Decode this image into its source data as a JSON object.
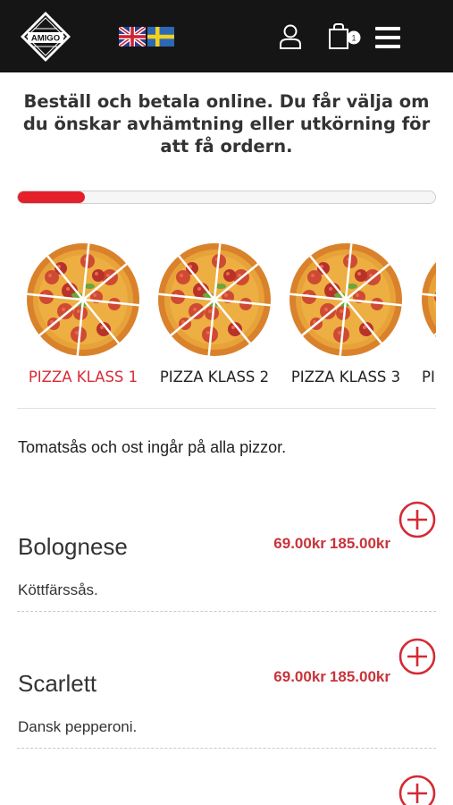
{
  "header": {
    "logo_text": "AMIGO",
    "languages": [
      "English",
      "Svenska"
    ],
    "cart_count": "1",
    "colors": {
      "bar": "#151515",
      "accent": "#e4202a"
    }
  },
  "intro": {
    "text": "Beställ och betala online. Du får välja om du önskar avhämtning eller utkörning för att få ordern."
  },
  "progress": {
    "value": 0.16
  },
  "categories": [
    {
      "label": "PIZZA KLASS 1",
      "active": true
    },
    {
      "label": "PIZZA KLASS 2",
      "active": false
    },
    {
      "label": "PIZZA KLASS 3",
      "active": false
    },
    {
      "label": "PI",
      "active": false
    }
  ],
  "note": "Tomatsås och ost ingår på alla pizzor.",
  "items": [
    {
      "name": "Bolognese",
      "price_small": "69.00kr",
      "price_large": "185.00kr",
      "description": "Köttfärssås."
    },
    {
      "name": "Scarlett",
      "price_small": "69.00kr",
      "price_large": "185.00kr",
      "description": "Dansk pepperoni."
    }
  ],
  "icons": [
    "logo-icon",
    "uk-flag-icon",
    "sweden-flag-icon",
    "user-icon",
    "cart-icon",
    "menu-icon",
    "pizza-icon",
    "add-icon"
  ]
}
